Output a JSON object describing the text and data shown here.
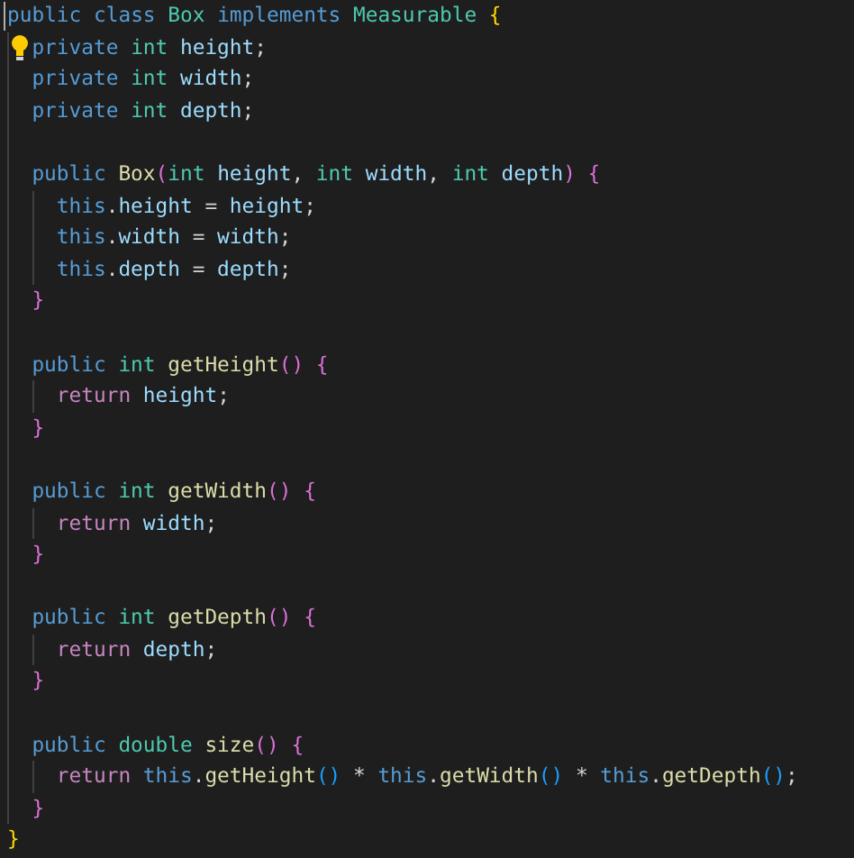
{
  "lines": [
    {
      "cursor": true,
      "tokens": [
        {
          "text": "public",
          "kind": "keyword"
        },
        {
          "text": "class",
          "kind": "keyword",
          "space_before": true
        },
        {
          "text": "Box",
          "kind": "type",
          "space_before": true
        },
        {
          "text": "implements",
          "kind": "keyword",
          "space_before": true
        },
        {
          "text": "Measurable",
          "kind": "type",
          "space_before": true
        },
        {
          "text": "{",
          "kind": "bracket1",
          "space_before": true
        }
      ],
      "children": [
        {
          "lightbulb": true,
          "tokens": [
            {
              "text": "private",
              "kind": "keyword"
            },
            {
              "text": "int",
              "kind": "type",
              "space_before": true
            },
            {
              "text": "height",
              "kind": "variable",
              "space_before": true
            },
            {
              "text": ";"
            }
          ]
        },
        {
          "tokens": [
            {
              "text": "private",
              "kind": "keyword"
            },
            {
              "text": "int",
              "kind": "type",
              "space_before": true
            },
            {
              "text": "width",
              "kind": "variable",
              "space_before": true
            },
            {
              "text": ";"
            }
          ]
        },
        {
          "tokens": [
            {
              "text": "private",
              "kind": "keyword"
            },
            {
              "text": "int",
              "kind": "type",
              "space_before": true
            },
            {
              "text": "depth",
              "kind": "variable",
              "space_before": true
            },
            {
              "text": ";"
            }
          ]
        },
        {
          "gap_before": true,
          "tokens": [
            {
              "text": "public",
              "kind": "keyword"
            },
            {
              "text": "Box",
              "kind": "function",
              "space_before": true
            },
            {
              "text": "(",
              "kind": "bracket2"
            },
            {
              "text": "int",
              "kind": "type"
            },
            {
              "text": "height",
              "kind": "variable",
              "space_before": true
            },
            {
              "text": ","
            },
            {
              "text": "int",
              "kind": "type",
              "space_before": true
            },
            {
              "text": "width",
              "kind": "variable",
              "space_before": true
            },
            {
              "text": ","
            },
            {
              "text": "int",
              "kind": "type",
              "space_before": true
            },
            {
              "text": "depth",
              "kind": "variable",
              "space_before": true
            },
            {
              "text": ")",
              "kind": "bracket2"
            },
            {
              "text": "{",
              "kind": "bracket2",
              "space_before": true
            }
          ],
          "children": [
            {
              "tokens": [
                {
                  "text": "this",
                  "kind": "keyword"
                },
                {
                  "text": "."
                },
                {
                  "text": "height",
                  "kind": "variable"
                },
                {
                  "text": "=",
                  "space_before": true
                },
                {
                  "text": "height",
                  "kind": "variable",
                  "space_before": true
                },
                {
                  "text": ";"
                }
              ]
            },
            {
              "tokens": [
                {
                  "text": "this",
                  "kind": "keyword"
                },
                {
                  "text": "."
                },
                {
                  "text": "width",
                  "kind": "variable"
                },
                {
                  "text": "=",
                  "space_before": true
                },
                {
                  "text": "width",
                  "kind": "variable",
                  "space_before": true
                },
                {
                  "text": ";"
                }
              ]
            },
            {
              "tokens": [
                {
                  "text": "this",
                  "kind": "keyword"
                },
                {
                  "text": "."
                },
                {
                  "text": "depth",
                  "kind": "variable"
                },
                {
                  "text": "=",
                  "space_before": true
                },
                {
                  "text": "depth",
                  "kind": "variable",
                  "space_before": true
                },
                {
                  "text": ";"
                }
              ]
            }
          ]
        },
        {
          "tokens": [
            {
              "text": "}",
              "kind": "bracket2"
            }
          ]
        },
        {
          "gap_before": true,
          "tokens": [
            {
              "text": "public",
              "kind": "keyword"
            },
            {
              "text": "int",
              "kind": "type",
              "space_before": true
            },
            {
              "text": "getHeight",
              "kind": "function",
              "space_before": true
            },
            {
              "text": "()",
              "kind": "bracket2"
            },
            {
              "text": "{",
              "kind": "bracket2",
              "space_before": true
            }
          ],
          "children": [
            {
              "tokens": [
                {
                  "text": "return",
                  "kind": "control"
                },
                {
                  "text": "height",
                  "kind": "variable",
                  "space_before": true
                },
                {
                  "text": ";"
                }
              ]
            }
          ]
        },
        {
          "tokens": [
            {
              "text": "}",
              "kind": "bracket2"
            }
          ]
        },
        {
          "gap_before": true,
          "tokens": [
            {
              "text": "public",
              "kind": "keyword"
            },
            {
              "text": "int",
              "kind": "type",
              "space_before": true
            },
            {
              "text": "getWidth",
              "kind": "function",
              "space_before": true
            },
            {
              "text": "()",
              "kind": "bracket2"
            },
            {
              "text": "{",
              "kind": "bracket2",
              "space_before": true
            }
          ],
          "children": [
            {
              "tokens": [
                {
                  "text": "return",
                  "kind": "control"
                },
                {
                  "text": "width",
                  "kind": "variable",
                  "space_before": true
                },
                {
                  "text": ";"
                }
              ]
            }
          ]
        },
        {
          "tokens": [
            {
              "text": "}",
              "kind": "bracket2"
            }
          ]
        },
        {
          "gap_before": true,
          "tokens": [
            {
              "text": "public",
              "kind": "keyword"
            },
            {
              "text": "int",
              "kind": "type",
              "space_before": true
            },
            {
              "text": "getDepth",
              "kind": "function",
              "space_before": true
            },
            {
              "text": "()",
              "kind": "bracket2"
            },
            {
              "text": "{",
              "kind": "bracket2",
              "space_before": true
            }
          ],
          "children": [
            {
              "tokens": [
                {
                  "text": "return",
                  "kind": "control"
                },
                {
                  "text": "depth",
                  "kind": "variable",
                  "space_before": true
                },
                {
                  "text": ";"
                }
              ]
            }
          ]
        },
        {
          "tokens": [
            {
              "text": "}",
              "kind": "bracket2"
            }
          ]
        },
        {
          "gap_before": true,
          "tokens": [
            {
              "text": "public",
              "kind": "keyword"
            },
            {
              "text": "double",
              "kind": "type",
              "space_before": true
            },
            {
              "text": "size",
              "kind": "function",
              "space_before": true
            },
            {
              "text": "()",
              "kind": "bracket2"
            },
            {
              "text": "{",
              "kind": "bracket2",
              "space_before": true
            }
          ],
          "children": [
            {
              "tokens": [
                {
                  "text": "return",
                  "kind": "control"
                },
                {
                  "text": "this",
                  "kind": "keyword",
                  "space_before": true
                },
                {
                  "text": "."
                },
                {
                  "text": "getHeight",
                  "kind": "function"
                },
                {
                  "text": "()",
                  "kind": "bracket3"
                },
                {
                  "text": "*",
                  "space_before": true
                },
                {
                  "text": "this",
                  "kind": "keyword",
                  "space_before": true
                },
                {
                  "text": "."
                },
                {
                  "text": "getWidth",
                  "kind": "function"
                },
                {
                  "text": "()",
                  "kind": "bracket3"
                },
                {
                  "text": "*",
                  "space_before": true
                },
                {
                  "text": "this",
                  "kind": "keyword",
                  "space_before": true
                },
                {
                  "text": "."
                },
                {
                  "text": "getDepth",
                  "kind": "function"
                },
                {
                  "text": "()",
                  "kind": "bracket3"
                },
                {
                  "text": ";"
                }
              ]
            }
          ]
        },
        {
          "tokens": [
            {
              "text": "}",
              "kind": "bracket2"
            }
          ]
        }
      ]
    },
    {
      "tokens": [
        {
          "text": "}",
          "kind": "bracket1"
        }
      ]
    }
  ]
}
